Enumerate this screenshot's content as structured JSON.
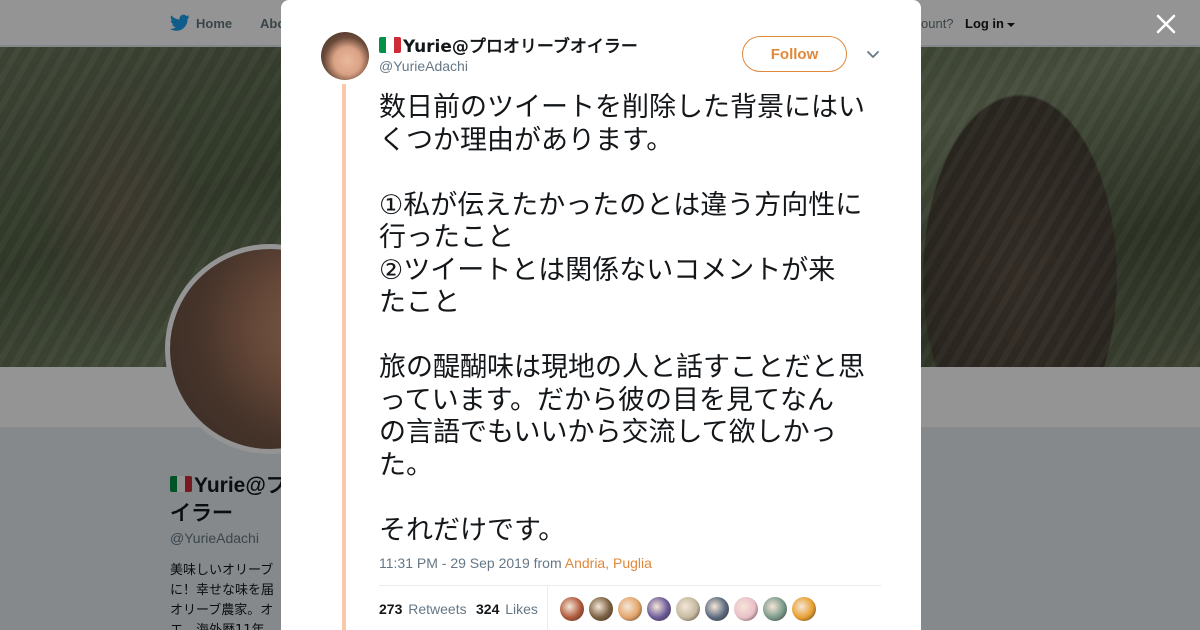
{
  "nav": {
    "home_label": "Home",
    "about_label": "Abo",
    "have_account": "ccount?",
    "login_label": "Log in"
  },
  "profile": {
    "name_flagless": "Yurie@プ",
    "name_line2": "イラー",
    "handle": "@YurieAdachi",
    "bio": "美味しいオリーブ\nに！幸せな味を届\nオリーブ農家。オ\nエ。海外歴11年"
  },
  "tweet": {
    "author_name": "Yurie@プロオリーブオイラー",
    "author_handle": "@YurieAdachi",
    "follow_label": "Follow",
    "text": "数日前のツイートを削除した背景にはい\nくつか理由があります。\n\n①私が伝えたかったのとは違う方向性に\n行ったこと\n②ツイートとは関係ないコメントが来\nたこと\n\n旅の醍醐味は現地の人と話すことだと思\nっています。だから彼の目を見てなん\nの言語でもいいから交流して欲しかっ\nた。\n\nそれだけです。",
    "time": "11:31 PM - 29 Sep 2019",
    "from_label": "from",
    "place": "Andria, Puglia",
    "retweets_count": "273",
    "retweets_label": "Retweets",
    "likes_count": "324",
    "likes_label": "Likes"
  },
  "colors": {
    "accent": "#e0883b",
    "thread": "#f9c8a7",
    "twitter_blue": "#1da1f2",
    "flag_green": "#009246",
    "flag_white": "#ffffff",
    "flag_red": "#ce2b37"
  },
  "icons": {
    "close": "close-icon",
    "bird": "twitter-bird-icon",
    "chevron": "chevron-down-icon"
  },
  "likers": [
    "#b0593a",
    "#7a6040",
    "#e3a46a",
    "#6b5a9a",
    "#c4b9a0",
    "#5a6a80",
    "#e9c0c8",
    "#7a9a8a",
    "#e8a030"
  ]
}
